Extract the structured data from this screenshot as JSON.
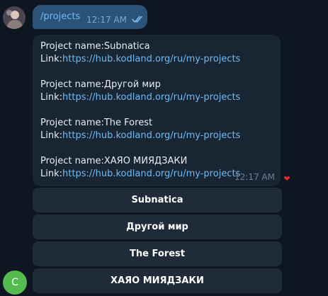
{
  "outgoing_message": {
    "text": "/projects",
    "time": "12:17 AM",
    "status_icon": "double-check-icon"
  },
  "incoming_message": {
    "projects": [
      {
        "name_label": "Project name:",
        "name": "Subnatica",
        "link_label": "Link:",
        "link": "https://hub.kodland.org/ru/my-projects"
      },
      {
        "name_label": "Project name:",
        "name": "Другой мир",
        "link_label": "Link:",
        "link": "https://hub.kodland.org/ru/my-projects"
      },
      {
        "name_label": "Project name:",
        "name": "The Forest",
        "link_label": "Link:",
        "link": "https://hub.kodland.org/ru/my-projects"
      },
      {
        "name_label": "Project name:",
        "name": "ХАЯО МИЯДЗАКИ",
        "link_label": "Link:",
        "link": "https://hub.kodland.org/ru/my-projects"
      }
    ],
    "time": "12:17 AM",
    "reaction": "❤"
  },
  "inline_keyboard": {
    "buttons": [
      "Subnatica",
      "Другой мир",
      "The Forest",
      "ХАЯО МИЯДЗАКИ"
    ]
  },
  "bot_avatar": {
    "initial": "C",
    "color": "#56bb4f"
  },
  "colors": {
    "background": "#0e1621",
    "outgoing_bubble": "#2b5278",
    "incoming_bubble": "#182533",
    "link": "#71baf2",
    "keyboard_button": "#1f2b39"
  }
}
